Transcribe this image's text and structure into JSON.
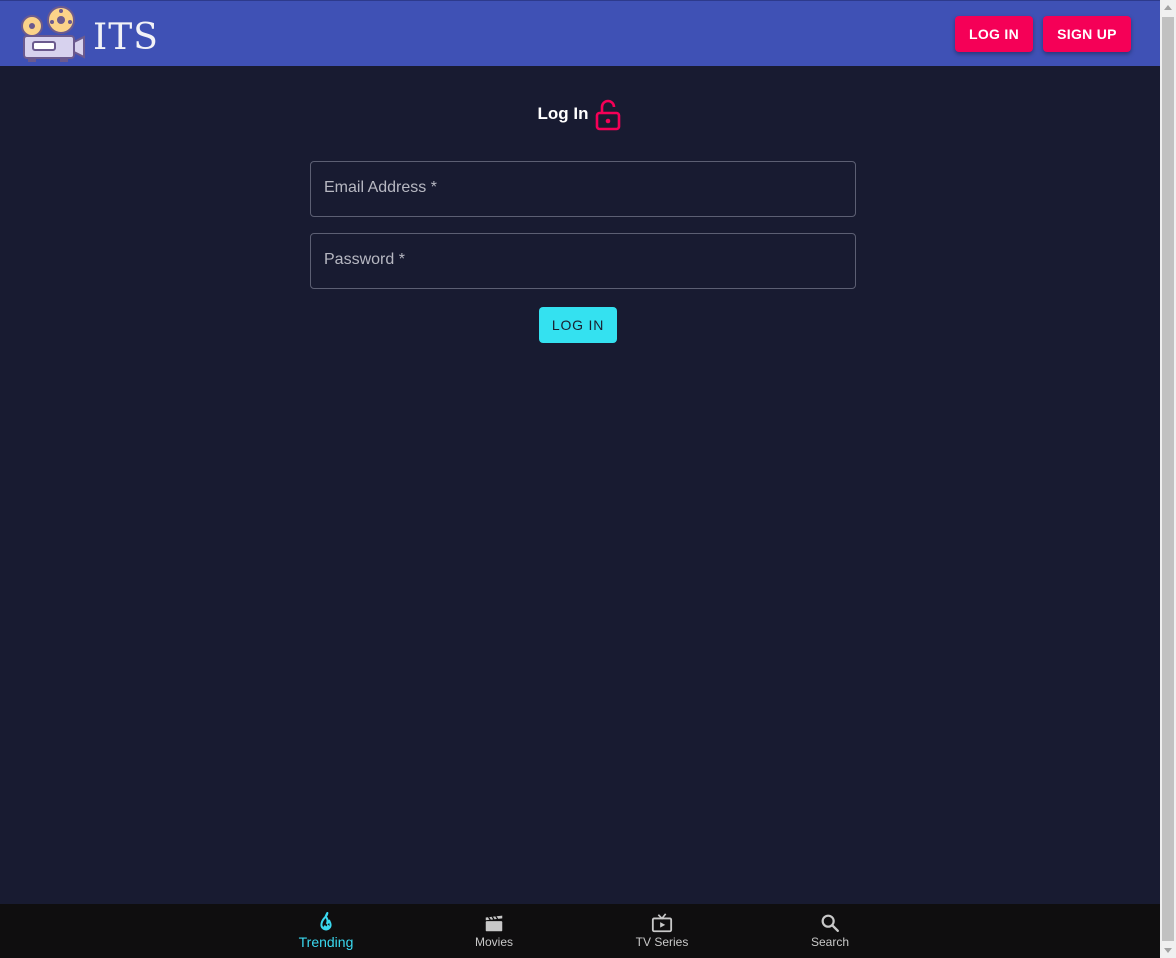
{
  "header": {
    "brand": "ITS",
    "login_label": "LOG IN",
    "signup_label": "SIGN UP",
    "bg_color": "#3f51b5",
    "button_color": "#f50057"
  },
  "form": {
    "title": "Log In",
    "email_label": "Email Address *",
    "password_label": "Password *",
    "submit_label": "LOG IN",
    "accent_color": "#34e1f0",
    "lock_icon": "lock-open-icon"
  },
  "bottom_nav": {
    "items": [
      {
        "label": "Trending",
        "icon": "whatshot-icon",
        "active": true
      },
      {
        "label": "Movies",
        "icon": "movie-icon",
        "active": false
      },
      {
        "label": "TV Series",
        "icon": "tv-icon",
        "active": false
      },
      {
        "label": "Search",
        "icon": "search-icon",
        "active": false
      }
    ],
    "active_color": "#3ad8ef"
  },
  "page": {
    "bg_color": "#181b31"
  }
}
